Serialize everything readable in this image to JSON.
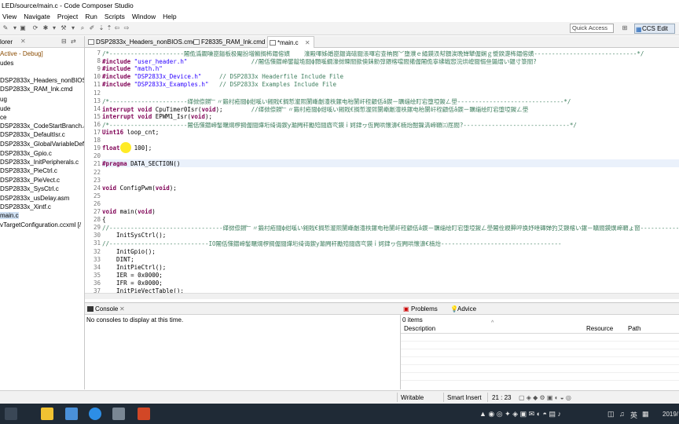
{
  "window": {
    "title": "LED/source/main.c - Code Composer Studio"
  },
  "menu": [
    "View",
    "Navigate",
    "Project",
    "Run",
    "Scripts",
    "Window",
    "Help"
  ],
  "toolbar": {
    "quick_access": "Quick Access",
    "perspective": "CCS Edit"
  },
  "left": {
    "tab": "lorer",
    "items": [
      "Active - Debug]",
      "udes",
      "DSP2833x_Headers_nonBIOS.c",
      "DSP2833x_RAM_lnk.cmd",
      "ug",
      "ude",
      "ce",
      "DSP2833x_CodeStartBranch.as",
      "DSP2833x_DefaultIsr.c",
      "DSP2833x_GlobalVariableDefs.",
      "DSP2833x_Gpio.c",
      "DSP2833x_InitPeripherals.c",
      "DSP2833x_PieCtrl.c",
      "DSP2833x_PieVect.c",
      "DSP2833x_SysCtrl.c",
      "DSP2833x_usDelay.asm",
      "DSP2833x_Xintf.c",
      "main.c",
      "vTargetConfiguration.ccxml [/"
    ]
  },
  "editor": {
    "tabs": [
      "DSP2833x_Headers_nonBIOS.cmd",
      "F28335_RAM_lnk.cmd",
      "*main.c"
    ],
    "lines": [
      {
        "n": "7",
        "t": "/*---------------------闂佹潙鐗嗛崑鎰板极閹扮増鏅搁柨鐕傛嫹    濠殿喗姊婚崑鎾诲礂閸涱喗宕查柟閭﹀墮濮ｅ繘鏌涢幇顖涘晩婵犫偓娴ｇ懓鍨濋柨鐕傛嫹-----------------------------*/"
      },
      {
        "n": "8",
        "t": "#include \"user_header.h\"                  //闂佸憡鐟崹鐢靛垝閸ф顥嗘繝濠傚暕閻撳倹銇勯弴鍡楁噹閻撯偓闂佹寧绋戦惌浣烘崲閸愵亝鍎熸い鎾寸箓閻?"
      },
      {
        "n": "9",
        "t": "#include \"math.h\""
      },
      {
        "n": "10",
        "t": "#include \"DSP2833x_Device.h\"     // DSP2833x Headerfile Include File"
      },
      {
        "n": "11",
        "t": "#include \"DSP2833x_Examples.h\"   // DSP2833x Examples Include File"
      },
      {
        "n": "12",
        "t": ""
      },
      {
        "n": "13",
        "t": "/*----------------------缂傚倷鐒﹂〃鍛村疮閸ф绀嗘い鎺戝€搁惁瀣煕閺嶃劌澧柣鏍电秮閺屽秷顧佸ǎ鍥ㄧ矋缁绘盯宕堕埡鍐ㄥ壆------------------------------*/"
      },
      {
        "n": "14",
        "t": "interrupt void CpuTimer0Isr(void);        //缂傚倷鐒﹂〃鍛村疮閸ф绀嗘い鎺戝€搁惁瀣煕閺嶃劌澧柣鏍电秮閺屽秷顧佸ǎ鍥ㄧ矋缁绘盯宕堕埡鍐ㄥ壆"
      },
      {
        "n": "15",
        "t": "interrupt void EPWM1_Isr(void);"
      },
      {
        "n": "16",
        "t": "/*----------------------闂佸憡鐟崹鍫曞焵椤掆偓閸燁垳绮诲鍥у瀭闁秆勵殕閸庮亪鏌ｉ妸銉ヮ仾闁哄懐濞€楠炲酣鎳滈崹顐㈢厒閻?------------------------------*/"
      },
      {
        "n": "17",
        "t": "Uint16 loop_cnt;"
      },
      {
        "n": "18",
        "t": ""
      },
      {
        "n": "19",
        "t": "float    100];"
      },
      {
        "n": "20",
        "t": ""
      },
      {
        "n": "21",
        "t": "#pragma DATA_SECTION()"
      },
      {
        "n": "22",
        "t": ""
      },
      {
        "n": "23",
        "t": ""
      },
      {
        "n": "24",
        "t": "void ConfigPwm(void);"
      },
      {
        "n": "25",
        "t": ""
      },
      {
        "n": "26",
        "t": ""
      },
      {
        "n": "27",
        "t": "void main(void)"
      },
      {
        "n": "28",
        "t": "{"
      },
      {
        "n": "29",
        "t": "//--------------------------------缂傚倷鐒﹂〃鍛村疮閸ф绀嗘い鎺戝€搁惁瀣煕閺嶃劌澧柣鏍电秮閺屽秷顧佸ǎ鍥ㄧ矋缁绘盯宕堕埡鍐ㄥ壆闂佺粯顨呯换妤呭磹婵犳艾鐭楁い鏍ㄧ矌閻鏌熼崹顐ょ窗----------------------------------"
      },
      {
        "n": "30",
        "t": "    InitSysCtrl();"
      },
      {
        "n": "31",
        "t": "//----------------------------IO闂佸憡鐟崹鍫曞焵椤掆偓閸燁垳绮诲鍥у瀭闁秆勵殕閸庮亪鏌ｉ妸銉ヮ仾闁哄懐濞€楠炲----------------------------------"
      },
      {
        "n": "32",
        "t": "    InitGpio();"
      },
      {
        "n": "33",
        "t": "    DINT;"
      },
      {
        "n": "34",
        "t": "    InitPieCtrl();"
      },
      {
        "n": "35",
        "t": "    IER = 0x0000;"
      },
      {
        "n": "36",
        "t": "    IFR = 0x0000;"
      },
      {
        "n": "37",
        "t": "    InitPieVectTable();"
      }
    ]
  },
  "console": {
    "tab": "Console",
    "empty": "No consoles to display at this time."
  },
  "problems": {
    "tab": "Problems",
    "tab2": "Advice",
    "count": "0 items",
    "columns": [
      "Description",
      "Resource",
      "Path"
    ]
  },
  "status": {
    "writable": "Writable",
    "insert": "Smart Insert",
    "position": "21 : 23"
  },
  "taskbar": {
    "ime": "英",
    "date": "2019/"
  },
  "colors": {
    "accent": "#1a5fb4",
    "comment": "#3f7f5f",
    "keyword": "#7f0055",
    "string": "#2a00ff"
  }
}
